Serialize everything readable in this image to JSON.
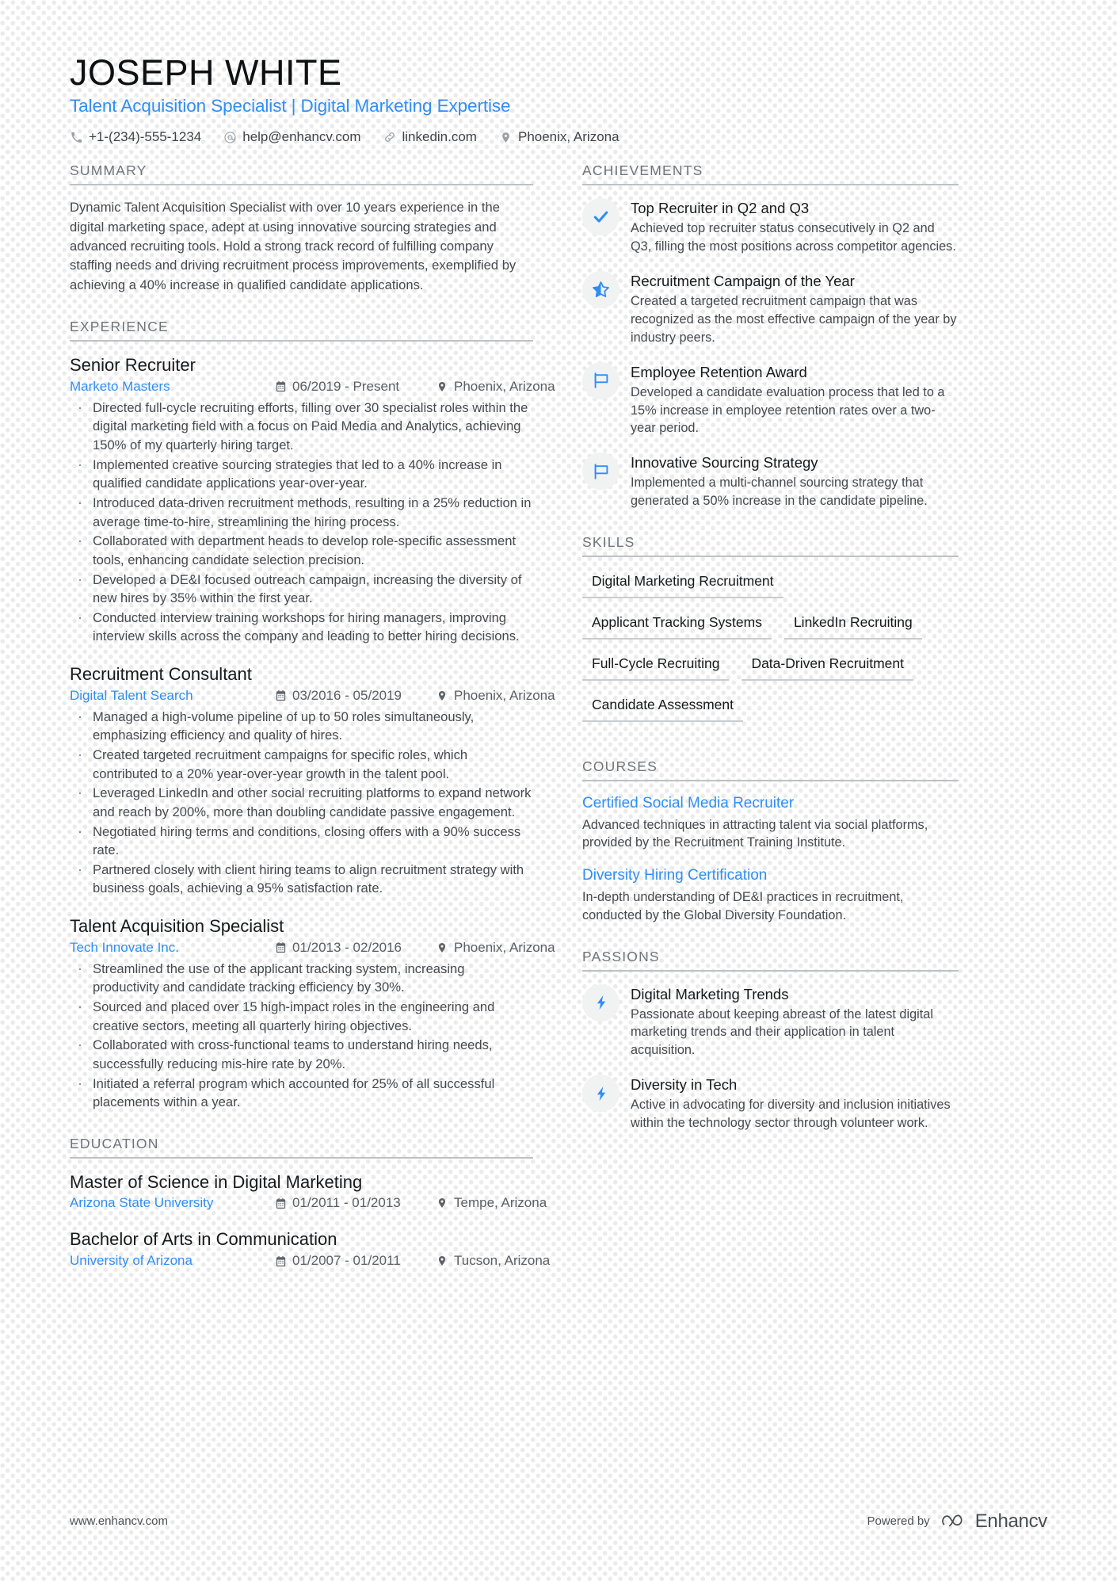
{
  "header": {
    "name": "JOSEPH WHITE",
    "role": "Talent Acquisition Specialist | Digital Marketing Expertise",
    "contacts": [
      {
        "icon": "phone-icon",
        "text": "+1-(234)-555-1234"
      },
      {
        "icon": "email-icon",
        "text": "help@enhancv.com"
      },
      {
        "icon": "link-icon",
        "text": "linkedin.com"
      },
      {
        "icon": "location-pin-icon",
        "text": "Phoenix, Arizona"
      }
    ]
  },
  "summary": {
    "title": "SUMMARY",
    "text": "Dynamic Talent Acquisition Specialist with over 10 years experience in the digital marketing space, adept at using innovative sourcing strategies and advanced recruiting tools. Hold a strong track record of fulfilling company staffing needs and driving recruitment process improvements, exemplified by achieving a 40% increase in qualified candidate applications."
  },
  "experience": {
    "title": "EXPERIENCE",
    "entries": [
      {
        "title": "Senior Recruiter",
        "company": "Marketo Masters",
        "date": "06/2019 - Present",
        "location": "Phoenix, Arizona",
        "bullets": [
          "Directed full-cycle recruiting efforts, filling over 30 specialist roles within the digital marketing field with a focus on Paid Media and Analytics, achieving 150% of my quarterly hiring target.",
          "Implemented creative sourcing strategies that led to a 40% increase in qualified candidate applications year-over-year.",
          "Introduced data-driven recruitment methods, resulting in a 25% reduction in average time-to-hire, streamlining the hiring process.",
          "Collaborated with department heads to develop role-specific assessment tools, enhancing candidate selection precision.",
          "Developed a DE&I focused outreach campaign, increasing the diversity of new hires by 35% within the first year.",
          "Conducted interview training workshops for hiring managers, improving interview skills across the company and leading to better hiring decisions."
        ]
      },
      {
        "title": "Recruitment Consultant",
        "company": "Digital Talent Search",
        "date": "03/2016 - 05/2019",
        "location": "Phoenix, Arizona",
        "bullets": [
          "Managed a high-volume pipeline of up to 50 roles simultaneously, emphasizing efficiency and quality of hires.",
          "Created targeted recruitment campaigns for specific roles, which contributed to a 20% year-over-year growth in the talent pool.",
          "Leveraged LinkedIn and other social recruiting platforms to expand network and reach by 200%, more than doubling candidate passive engagement.",
          "Negotiated hiring terms and conditions, closing offers with a 90% success rate.",
          "Partnered closely with client hiring teams to align recruitment strategy with business goals, achieving a 95% satisfaction rate."
        ]
      },
      {
        "title": "Talent Acquisition Specialist",
        "company": "Tech Innovate Inc.",
        "date": "01/2013 - 02/2016",
        "location": "Phoenix, Arizona",
        "bullets": [
          "Streamlined the use of the applicant tracking system, increasing productivity and candidate tracking efficiency by 30%.",
          "Sourced and placed over 15 high-impact roles in the engineering and creative sectors, meeting all quarterly hiring objectives.",
          "Collaborated with cross-functional teams to understand hiring needs, successfully reducing mis-hire rate by 20%.",
          "Initiated a referral program which accounted for 25% of all successful placements within a year."
        ]
      }
    ]
  },
  "education": {
    "title": "EDUCATION",
    "entries": [
      {
        "title": "Master of Science in Digital Marketing",
        "company": "Arizona State University",
        "date": "01/2011 - 01/2013",
        "location": "Tempe, Arizona"
      },
      {
        "title": "Bachelor of Arts in Communication",
        "company": "University of Arizona",
        "date": "01/2007 - 01/2011",
        "location": "Tucson, Arizona"
      }
    ]
  },
  "achievements": {
    "title": "ACHIEVEMENTS",
    "items": [
      {
        "icon": "check-icon",
        "title": "Top Recruiter in Q2 and Q3",
        "desc": "Achieved top recruiter status consecutively in Q2 and Q3, filling the most positions across competitor agencies."
      },
      {
        "icon": "star-half-icon",
        "title": "Recruitment Campaign of the Year",
        "desc": "Created a targeted recruitment campaign that was recognized as the most effective campaign of the year by industry peers."
      },
      {
        "icon": "flag-icon",
        "title": "Employee Retention Award",
        "desc": "Developed a candidate evaluation process that led to a 15% increase in employee retention rates over a two-year period."
      },
      {
        "icon": "flag-icon",
        "title": "Innovative Sourcing Strategy",
        "desc": "Implemented a multi-channel sourcing strategy that generated a 50% increase in the candidate pipeline."
      }
    ]
  },
  "skills": {
    "title": "SKILLS",
    "items": [
      "Digital Marketing Recruitment",
      "Applicant Tracking Systems",
      "LinkedIn Recruiting",
      "Full-Cycle Recruiting",
      "Data-Driven Recruitment",
      "Candidate Assessment"
    ]
  },
  "courses": {
    "title": "COURSES",
    "items": [
      {
        "title": "Certified Social Media Recruiter",
        "desc": "Advanced techniques in attracting talent via social platforms, provided by the Recruitment Training Institute."
      },
      {
        "title": "Diversity Hiring Certification",
        "desc": "In-depth understanding of DE&I practices in recruitment, conducted by the Global Diversity Foundation."
      }
    ]
  },
  "passions": {
    "title": "PASSIONS",
    "items": [
      {
        "icon": "bolt-icon",
        "title": "Digital Marketing Trends",
        "desc": "Passionate about keeping abreast of the latest digital marketing trends and their application in talent acquisition."
      },
      {
        "icon": "bolt-icon",
        "title": "Diversity in Tech",
        "desc": "Active in advocating for diversity and inclusion initiatives within the technology sector through volunteer work."
      }
    ]
  },
  "footer": {
    "website": "www.enhancv.com",
    "powered_by": "Powered by",
    "brand": "Enhancv"
  },
  "colors": {
    "accent": "#2f8ef4",
    "text": "#454a4f",
    "heading": "#17191b",
    "rule": "#bdc1c4",
    "dot": "#ebebeb"
  }
}
